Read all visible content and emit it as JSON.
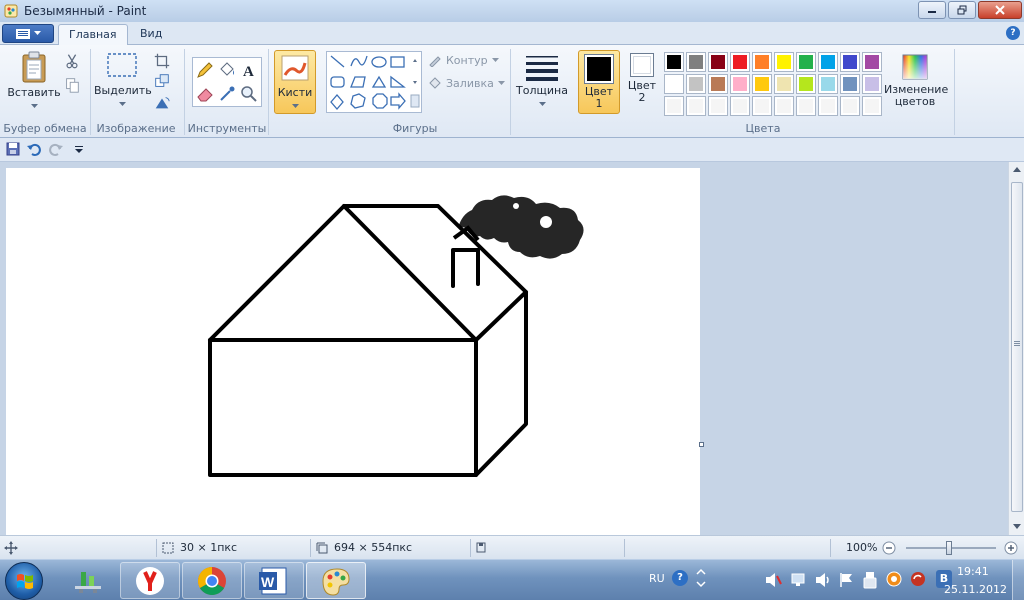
{
  "window": {
    "title": "Безымянный - Paint",
    "minimize_icon": "minimize-icon",
    "maximize_icon": "restore-icon",
    "close_icon": "close-icon"
  },
  "tabs": [
    {
      "label": "Главная",
      "active": true
    },
    {
      "label": "Вид",
      "active": false
    }
  ],
  "ribbon": {
    "clipboard": {
      "group_label": "Буфер обмена",
      "paste_label": "Вставить",
      "cut_icon": "scissors-icon",
      "copy_icon": "copy-icon"
    },
    "image": {
      "group_label": "Изображение",
      "select_label": "Выделить",
      "crop_icon": "crop-icon",
      "resize_icon": "resize-icon",
      "rotate_icon": "rotate-icon"
    },
    "tools": {
      "group_label": "Инструменты",
      "items": [
        "pencil-icon",
        "fill-icon",
        "text-icon",
        "eraser-icon",
        "color-picker-icon",
        "magnifier-icon"
      ]
    },
    "brushes": {
      "label": "Кисти"
    },
    "shapes": {
      "group_label": "Фигуры",
      "outline_label": "Контур",
      "fill_label": "Заливка"
    },
    "thickness_label": "Толщина",
    "colors": {
      "group_label": "Цвета",
      "color1_label": "Цвет 1",
      "color2_label": "Цвет 2",
      "edit_label": "Изменение цветов",
      "color1": "#000000",
      "color2": "#ffffff",
      "palette_row1": [
        "#000000",
        "#7f7f7f",
        "#880015",
        "#ed1c24",
        "#ff7f27",
        "#fff200",
        "#22b14c",
        "#00a2e8",
        "#3f48cc",
        "#a349a4"
      ],
      "palette_row2": [
        "#ffffff",
        "#c3c3c3",
        "#b97a57",
        "#ffaec9",
        "#ffc90e",
        "#efe4b0",
        "#b5e61d",
        "#99d9ea",
        "#7092be",
        "#c8bfe7"
      ],
      "palette_row3": [
        "#f5f5f5",
        "#f5f5f5",
        "#f5f5f5",
        "#f5f5f5",
        "#f5f5f5",
        "#f5f5f5",
        "#f5f5f5",
        "#f5f5f5",
        "#f5f5f5",
        "#f5f5f5"
      ]
    }
  },
  "qat": {
    "save_icon": "save-icon",
    "undo_icon": "undo-icon",
    "redo_icon": "redo-icon",
    "customize_icon": "dropdown-icon"
  },
  "status": {
    "cursor_icon": "move-cursor-icon",
    "selection_size": "30 × 1пкс",
    "image_size": "694 × 554пкс",
    "zoom": "100%"
  },
  "taskbar": {
    "apps": [
      "network-icon",
      "yandex-browser-icon",
      "chrome-icon",
      "word-icon",
      "paint-icon"
    ],
    "language": "RU",
    "time": "19:41",
    "date": "25.11.2012"
  }
}
